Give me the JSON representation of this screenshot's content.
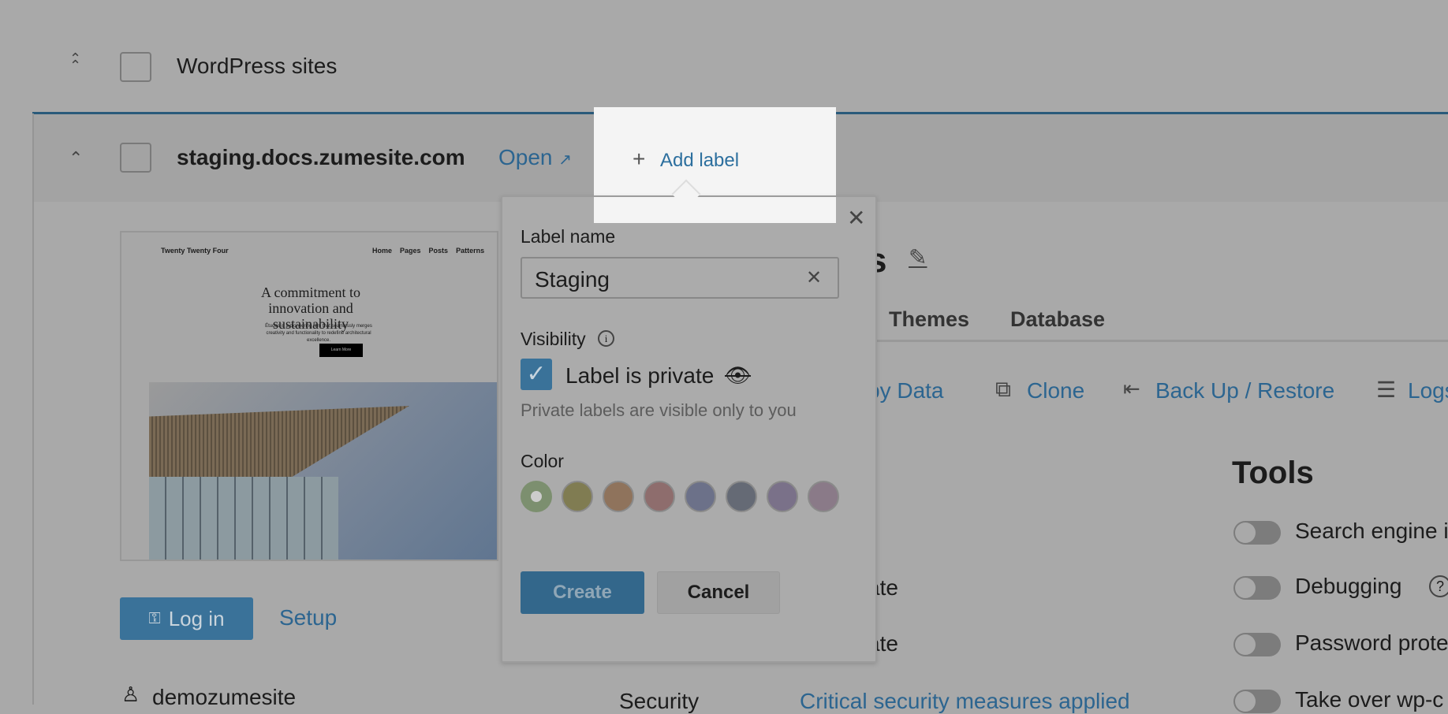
{
  "group": {
    "title": "WordPress sites"
  },
  "site": {
    "domain": "staging.docs.zumesite.com",
    "open_label": "Open",
    "add_label": "Add label",
    "title_partial": "s",
    "tabs": [
      "Themes",
      "Database"
    ],
    "actions": [
      "py Data",
      "Clone",
      "Back Up / Restore",
      "Logs"
    ],
    "login_label": "Log in",
    "setup_label": "Setup",
    "username": "demozumesite",
    "rows": [
      "ate",
      "ate"
    ],
    "security_label": "Security",
    "security_value": "Critical security measures applied",
    "preview": {
      "site_name": "Twenty Twenty Four",
      "nav": [
        "Home",
        "Pages",
        "Posts",
        "Patterns"
      ],
      "headline": "A commitment to innovation and sustainability",
      "body": "Études is a pioneering firm that seamlessly merges creativity and functionality to redefine architectural excellence.",
      "cta": "Learn More"
    }
  },
  "tools": {
    "title": "Tools",
    "items": [
      {
        "label": "Search engine i",
        "on": false
      },
      {
        "label": "Debugging",
        "on": false
      },
      {
        "label": "Password prote",
        "on": false
      },
      {
        "label": "Take over wp-c",
        "on": false
      }
    ]
  },
  "popover": {
    "label_name": "Label name",
    "input_value": "Staging",
    "visibility": "Visibility",
    "private_label": "Label is private",
    "private_checked": true,
    "help": "Private labels are visible only to you",
    "color": "Color",
    "colors": [
      "#7c8f6f",
      "#807c52",
      "#8f735c",
      "#8e6d6d",
      "#6c7189",
      "#656a75",
      "#7a7189",
      "#8a7a88"
    ],
    "selected_color": "#7c8f6f",
    "create": "Create",
    "cancel": "Cancel"
  }
}
